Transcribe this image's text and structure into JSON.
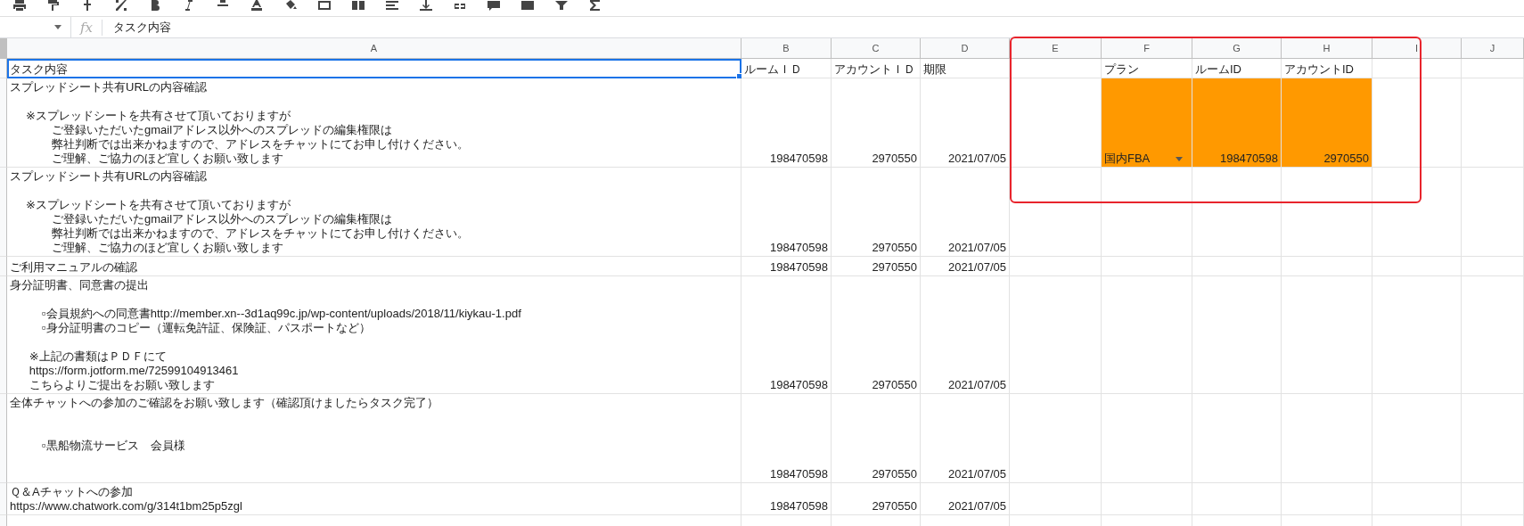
{
  "formula_bar": {
    "fx_label": "fx",
    "value": "タスク内容"
  },
  "columns": [
    "A",
    "B",
    "C",
    "D",
    "E",
    "F",
    "G",
    "H",
    "I",
    "J"
  ],
  "rows": [
    {
      "A": {
        "lines": [
          {
            "kind": "text",
            "text": "タスク内容"
          }
        ],
        "selected": true
      },
      "B": {
        "kind": "text",
        "text": "ルームＩＤ",
        "selected": false
      },
      "C": {
        "kind": "text",
        "text": "アカウントＩＤ",
        "selected": false
      },
      "D": {
        "kind": "text",
        "text": "期限",
        "selected": false
      },
      "F": {
        "kind": "text",
        "text": "プラン",
        "selected": false
      },
      "G": {
        "kind": "text",
        "text": "ルームID",
        "selected": false
      },
      "H": {
        "kind": "text",
        "text": "アカウントID",
        "selected": false
      }
    },
    {
      "A": {
        "lines": [
          {
            "kind": "text",
            "text": "スプレッドシート共有URLの内容確認"
          },
          {
            "kind": "blank"
          },
          {
            "kind": "text",
            "text": "     ※スプレッドシートを共有させて頂いておりますが"
          },
          {
            "kind": "text",
            "text": "             ご登録いただいたgmailアドレス以外へのスプレッドの編集権限は"
          },
          {
            "kind": "text",
            "text": "             弊社判断では出来かねますので、アドレスをチャットにてお申し付けください。"
          },
          {
            "kind": "text",
            "text": "             ご理解、ご協力のほど宜しくお願い致します"
          }
        ],
        "selected": false
      },
      "B": {
        "kind": "number",
        "text": "198470598",
        "selected": false
      },
      "C": {
        "kind": "number",
        "text": "2970550",
        "selected": false
      },
      "D": {
        "kind": "number",
        "text": "2021/07/05",
        "selected": false
      },
      "F": {
        "kind": "text",
        "text": "国内FBA",
        "selected": false,
        "highlighted": true,
        "dropdown": true
      },
      "G": {
        "kind": "number",
        "text": "198470598",
        "selected": false,
        "highlighted": true
      },
      "H": {
        "kind": "number",
        "text": "2970550",
        "selected": false,
        "highlighted": true
      }
    },
    {
      "A": {
        "lines": [
          {
            "kind": "text",
            "text": "スプレッドシート共有URLの内容確認"
          },
          {
            "kind": "blank"
          },
          {
            "kind": "text",
            "text": "     ※スプレッドシートを共有させて頂いておりますが"
          },
          {
            "kind": "text",
            "text": "             ご登録いただいたgmailアドレス以外へのスプレッドの編集権限は"
          },
          {
            "kind": "text",
            "text": "             弊社判断では出来かねますので、アドレスをチャットにてお申し付けください。"
          },
          {
            "kind": "text",
            "text": "             ご理解、ご協力のほど宜しくお願い致します"
          }
        ],
        "selected": false
      },
      "B": {
        "kind": "number",
        "text": "198470598",
        "selected": false
      },
      "C": {
        "kind": "number",
        "text": "2970550",
        "selected": false
      },
      "D": {
        "kind": "number",
        "text": "2021/07/05",
        "selected": false
      }
    },
    {
      "A": {
        "lines": [
          {
            "kind": "text",
            "text": "ご利用マニュアルの確認"
          }
        ],
        "selected": false
      },
      "B": {
        "kind": "number",
        "text": "198470598",
        "selected": false
      },
      "C": {
        "kind": "number",
        "text": "2970550",
        "selected": false
      },
      "D": {
        "kind": "number",
        "text": "2021/07/05",
        "selected": false
      }
    },
    {
      "A": {
        "lines": [
          {
            "kind": "text",
            "text": "身分証明書、同意書の提出"
          },
          {
            "kind": "blank"
          },
          {
            "kind": "text",
            "text": "          ▫会員規約への同意書http://member.xn--3d1aq99c.jp/wp-content/uploads/2018/11/kiykau-1.pdf"
          },
          {
            "kind": "text",
            "text": "          ▫身分証明書のコピー（運転免許証、保険証、パスポートなど）"
          },
          {
            "kind": "blank"
          },
          {
            "kind": "text",
            "text": "      ※上記の書類はＰＤＦにて"
          },
          {
            "kind": "text",
            "text": "      https://form.jotform.me/72599104913461"
          },
          {
            "kind": "text",
            "text": "      こちらよりご提出をお願い致します"
          }
        ],
        "selected": false
      },
      "B": {
        "kind": "number",
        "text": "198470598",
        "selected": false
      },
      "C": {
        "kind": "number",
        "text": "2970550",
        "selected": false
      },
      "D": {
        "kind": "number",
        "text": "2021/07/05",
        "selected": false
      }
    },
    {
      "A": {
        "lines": [
          {
            "kind": "text",
            "text": "全体チャットへの参加のご確認をお願い致します（確認頂けましたらタスク完了）"
          },
          {
            "kind": "blank"
          },
          {
            "kind": "blank"
          },
          {
            "kind": "text",
            "text": "          ▫黒船物流サービス　会員様"
          },
          {
            "kind": "blank"
          },
          {
            "kind": "blank"
          }
        ],
        "selected": false
      },
      "B": {
        "kind": "number",
        "text": "198470598",
        "selected": false
      },
      "C": {
        "kind": "number",
        "text": "2970550",
        "selected": false
      },
      "D": {
        "kind": "number",
        "text": "2021/07/05",
        "selected": false
      }
    },
    {
      "A": {
        "lines": [
          {
            "kind": "text",
            "text": "Ｑ＆Aチャットへの参加"
          },
          {
            "kind": "text",
            "text": "https://www.chatwork.com/g/314t1bm25p5zgl"
          }
        ],
        "selected": false
      },
      "B": {
        "kind": "number",
        "text": "198470598",
        "selected": false
      },
      "C": {
        "kind": "number",
        "text": "2970550",
        "selected": false
      },
      "D": {
        "kind": "number",
        "text": "2021/07/05",
        "selected": false
      }
    }
  ]
}
